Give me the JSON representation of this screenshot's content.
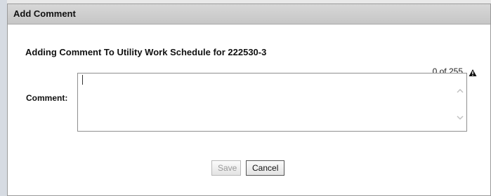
{
  "dialog": {
    "title": "Add Comment",
    "heading": "Adding Comment To Utility Work Schedule for 222530-3",
    "counter": "0 of 255",
    "comment_label": "Comment:",
    "comment_value": "",
    "save_label": "Save",
    "cancel_label": "Cancel"
  },
  "icons": {
    "warning": "warning-triangle-icon",
    "scroll_up": "chevron-up-icon",
    "scroll_down": "chevron-down-icon"
  }
}
